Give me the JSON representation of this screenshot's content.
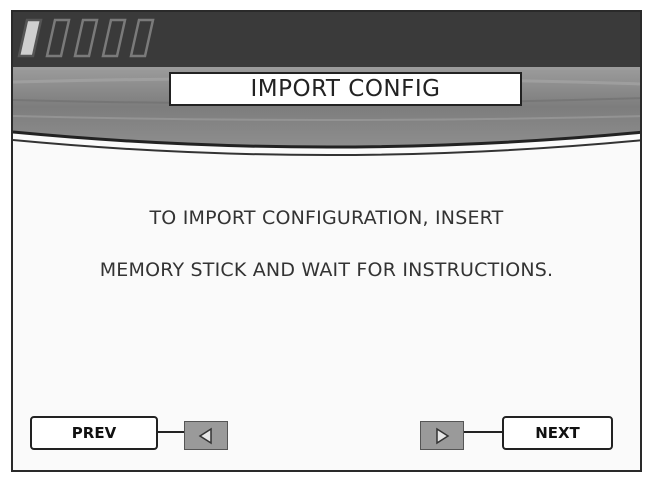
{
  "header": {
    "title": "IMPORT CONFIG",
    "signal_icon": "signal-bars-icon",
    "bar_color": "#3a3a3a",
    "band_color": "#8a8a8a"
  },
  "message": {
    "line1": "TO IMPORT CONFIGURATION, INSERT",
    "line2": "MEMORY STICK AND WAIT FOR INSTRUCTIONS."
  },
  "navigation": {
    "prev_label": "PREV",
    "next_label": "NEXT",
    "prev_icon": "triangle-left-icon",
    "next_icon": "triangle-right-icon"
  }
}
